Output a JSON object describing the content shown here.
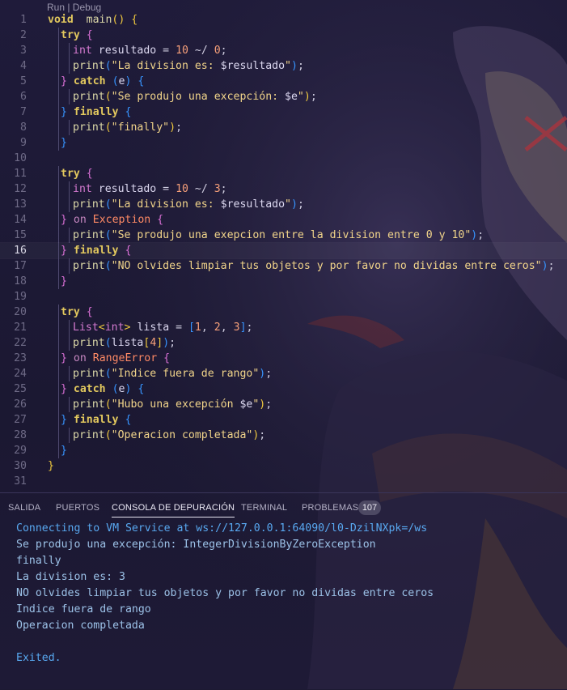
{
  "codelens": "Run | Debug",
  "active_line": 16,
  "lines": [
    {
      "n": "1",
      "tokens": [
        [
          "kw",
          "void"
        ],
        [
          "",
          "  "
        ],
        [
          "fn",
          "main"
        ],
        [
          "br1",
          "()"
        ],
        [
          "",
          " "
        ],
        [
          "br1",
          "{"
        ]
      ]
    },
    {
      "n": "2",
      "indent": 1,
      "tokens": [
        [
          "kw",
          "try"
        ],
        [
          "",
          " "
        ],
        [
          "br2",
          "{"
        ]
      ]
    },
    {
      "n": "3",
      "indent": 2,
      "tokens": [
        [
          "ty",
          "int"
        ],
        [
          "var",
          " resultado "
        ],
        [
          "",
          "= "
        ],
        [
          "num",
          "10"
        ],
        [
          "",
          " ~/ "
        ],
        [
          "num",
          "0"
        ],
        [
          "",
          ";"
        ]
      ]
    },
    {
      "n": "4",
      "indent": 2,
      "tokens": [
        [
          "fn",
          "print"
        ],
        [
          "br3",
          "("
        ],
        [
          "str",
          "\"La division es: "
        ],
        [
          "var",
          "$resultado"
        ],
        [
          "str",
          "\""
        ],
        [
          "br3",
          ")"
        ],
        [
          "",
          ";"
        ]
      ]
    },
    {
      "n": "5",
      "indent": 1,
      "tokens": [
        [
          "br2",
          "}"
        ],
        [
          "",
          " "
        ],
        [
          "kw",
          "catch"
        ],
        [
          "",
          " "
        ],
        [
          "br3",
          "("
        ],
        [
          "var",
          "e"
        ],
        [
          "br3",
          ")"
        ],
        [
          "",
          " "
        ],
        [
          "br3",
          "{"
        ]
      ]
    },
    {
      "n": "6",
      "indent": 2,
      "tokens": [
        [
          "fn",
          "print"
        ],
        [
          "br1",
          "("
        ],
        [
          "str",
          "\"Se produjo una excepción: "
        ],
        [
          "var",
          "$e"
        ],
        [
          "str",
          "\""
        ],
        [
          "br1",
          ")"
        ],
        [
          "",
          ";"
        ]
      ]
    },
    {
      "n": "7",
      "indent": 1,
      "tokens": [
        [
          "br3",
          "}"
        ],
        [
          "",
          " "
        ],
        [
          "kw",
          "finally"
        ],
        [
          "",
          " "
        ],
        [
          "br3",
          "{"
        ]
      ]
    },
    {
      "n": "8",
      "indent": 2,
      "tokens": [
        [
          "fn",
          "print"
        ],
        [
          "br1",
          "("
        ],
        [
          "str",
          "\"finally\""
        ],
        [
          "br1",
          ")"
        ],
        [
          "",
          ";"
        ]
      ]
    },
    {
      "n": "9",
      "indent": 1,
      "tokens": [
        [
          "br3",
          "}"
        ]
      ]
    },
    {
      "n": "10",
      "indent": 0,
      "tokens": []
    },
    {
      "n": "11",
      "indent": 1,
      "tokens": [
        [
          "kw",
          "try"
        ],
        [
          "",
          " "
        ],
        [
          "br2",
          "{"
        ]
      ]
    },
    {
      "n": "12",
      "indent": 2,
      "tokens": [
        [
          "ty",
          "int"
        ],
        [
          "var",
          " resultado "
        ],
        [
          "",
          "= "
        ],
        [
          "num",
          "10"
        ],
        [
          "",
          " ~/ "
        ],
        [
          "num",
          "3"
        ],
        [
          "",
          ";"
        ]
      ]
    },
    {
      "n": "13",
      "indent": 2,
      "tokens": [
        [
          "fn",
          "print"
        ],
        [
          "br3",
          "("
        ],
        [
          "str",
          "\"La division es: "
        ],
        [
          "var",
          "$resultado"
        ],
        [
          "str",
          "\""
        ],
        [
          "br3",
          ")"
        ],
        [
          "",
          ";"
        ]
      ]
    },
    {
      "n": "14",
      "indent": 1,
      "tokens": [
        [
          "br2",
          "}"
        ],
        [
          "",
          " "
        ],
        [
          "kw2",
          "on"
        ],
        [
          "",
          " "
        ],
        [
          "cls",
          "Exception"
        ],
        [
          "",
          " "
        ],
        [
          "br2",
          "{"
        ]
      ]
    },
    {
      "n": "15",
      "indent": 2,
      "tokens": [
        [
          "fn",
          "print"
        ],
        [
          "br3",
          "("
        ],
        [
          "str",
          "\"Se produjo una exepcion entre la division entre 0 y 10\""
        ],
        [
          "br3",
          ")"
        ],
        [
          "",
          ";"
        ]
      ]
    },
    {
      "n": "16",
      "indent": 1,
      "tokens": [
        [
          "br2",
          "}"
        ],
        [
          "",
          " "
        ],
        [
          "kw",
          "finally"
        ],
        [
          "",
          " "
        ],
        [
          "br2",
          "{"
        ]
      ]
    },
    {
      "n": "17",
      "indent": 2,
      "tokens": [
        [
          "fn",
          "print"
        ],
        [
          "br3",
          "("
        ],
        [
          "str",
          "\"NO olvides limpiar tus objetos y por favor no dividas entre ceros\""
        ],
        [
          "br3",
          ")"
        ],
        [
          "",
          ";"
        ]
      ]
    },
    {
      "n": "18",
      "indent": 1,
      "tokens": [
        [
          "br2",
          "}"
        ]
      ]
    },
    {
      "n": "19",
      "indent": 0,
      "tokens": []
    },
    {
      "n": "20",
      "indent": 1,
      "tokens": [
        [
          "kw",
          "try"
        ],
        [
          "",
          " "
        ],
        [
          "br2",
          "{"
        ]
      ]
    },
    {
      "n": "21",
      "indent": 2,
      "tokens": [
        [
          "ty",
          "List"
        ],
        [
          "br1",
          "<"
        ],
        [
          "ty",
          "int"
        ],
        [
          "br1",
          ">"
        ],
        [
          "var",
          " lista "
        ],
        [
          "",
          "= "
        ],
        [
          "br3",
          "["
        ],
        [
          "num",
          "1"
        ],
        [
          "",
          ", "
        ],
        [
          "num",
          "2"
        ],
        [
          "",
          ", "
        ],
        [
          "num",
          "3"
        ],
        [
          "br3",
          "]"
        ],
        [
          "",
          ";"
        ]
      ]
    },
    {
      "n": "22",
      "indent": 2,
      "tokens": [
        [
          "fn",
          "print"
        ],
        [
          "br3",
          "("
        ],
        [
          "var",
          "lista"
        ],
        [
          "br1",
          "["
        ],
        [
          "num",
          "4"
        ],
        [
          "br1",
          "]"
        ],
        [
          "br3",
          ")"
        ],
        [
          "",
          ";"
        ]
      ]
    },
    {
      "n": "23",
      "indent": 1,
      "tokens": [
        [
          "br2",
          "}"
        ],
        [
          "",
          " "
        ],
        [
          "kw2",
          "on"
        ],
        [
          "",
          " "
        ],
        [
          "cls",
          "RangeError"
        ],
        [
          "",
          " "
        ],
        [
          "br2",
          "{"
        ]
      ]
    },
    {
      "n": "24",
      "indent": 2,
      "tokens": [
        [
          "fn",
          "print"
        ],
        [
          "br3",
          "("
        ],
        [
          "str",
          "\"Indice fuera de rango\""
        ],
        [
          "br3",
          ")"
        ],
        [
          "",
          ";"
        ]
      ]
    },
    {
      "n": "25",
      "indent": 1,
      "tokens": [
        [
          "br2",
          "}"
        ],
        [
          "",
          " "
        ],
        [
          "kw",
          "catch"
        ],
        [
          "",
          " "
        ],
        [
          "br3",
          "("
        ],
        [
          "var",
          "e"
        ],
        [
          "br3",
          ")"
        ],
        [
          "",
          " "
        ],
        [
          "br3",
          "{"
        ]
      ]
    },
    {
      "n": "26",
      "indent": 2,
      "tokens": [
        [
          "fn",
          "print"
        ],
        [
          "br1",
          "("
        ],
        [
          "str",
          "\"Hubo una excepción "
        ],
        [
          "var",
          "$e"
        ],
        [
          "str",
          "\""
        ],
        [
          "br1",
          ")"
        ],
        [
          "",
          ";"
        ]
      ]
    },
    {
      "n": "27",
      "indent": 1,
      "tokens": [
        [
          "br3",
          "}"
        ],
        [
          "",
          " "
        ],
        [
          "kw",
          "finally"
        ],
        [
          "",
          " "
        ],
        [
          "br3",
          "{"
        ]
      ]
    },
    {
      "n": "28",
      "indent": 2,
      "tokens": [
        [
          "fn",
          "print"
        ],
        [
          "br1",
          "("
        ],
        [
          "str",
          "\"Operacion completada\""
        ],
        [
          "br1",
          ")"
        ],
        [
          "",
          ";"
        ]
      ]
    },
    {
      "n": "29",
      "indent": 1,
      "tokens": [
        [
          "br3",
          "}"
        ]
      ]
    },
    {
      "n": "30",
      "indent": 0,
      "tokens": [
        [
          "br1",
          "}"
        ]
      ]
    },
    {
      "n": "31",
      "indent": 0,
      "tokens": []
    }
  ],
  "panel": {
    "tabs": [
      {
        "label": "SALIDA",
        "active": false
      },
      {
        "label": "PUERTOS",
        "active": false
      },
      {
        "label": "CONSOLA DE DEPURACIÓN",
        "active": true
      },
      {
        "label": "TERMINAL",
        "active": false
      },
      {
        "label": "PROBLEMAS",
        "active": false
      }
    ],
    "problems_count": "107",
    "console": [
      {
        "text": "Connecting to VM Service at ws://127.0.0.1:64090/l0-DzilNXpk=/ws",
        "style": "c-blue"
      },
      {
        "text": "Se produjo una excepción: IntegerDivisionByZeroException",
        "style": "c-norm"
      },
      {
        "text": "finally",
        "style": "c-norm"
      },
      {
        "text": "La division es: 3",
        "style": "c-norm"
      },
      {
        "text": "NO olvides limpiar tus objetos y por favor no dividas entre ceros",
        "style": "c-norm"
      },
      {
        "text": "Indice fuera de rango",
        "style": "c-norm"
      },
      {
        "text": "Operacion completada",
        "style": "c-norm"
      },
      {
        "text": "",
        "style": "c-norm"
      },
      {
        "text": "Exited.",
        "style": "c-blue"
      }
    ]
  },
  "colors": {
    "background": "#1d1a33",
    "keyword": "#e2c85e",
    "string": "#f1d48a",
    "number": "#f7a07a"
  }
}
